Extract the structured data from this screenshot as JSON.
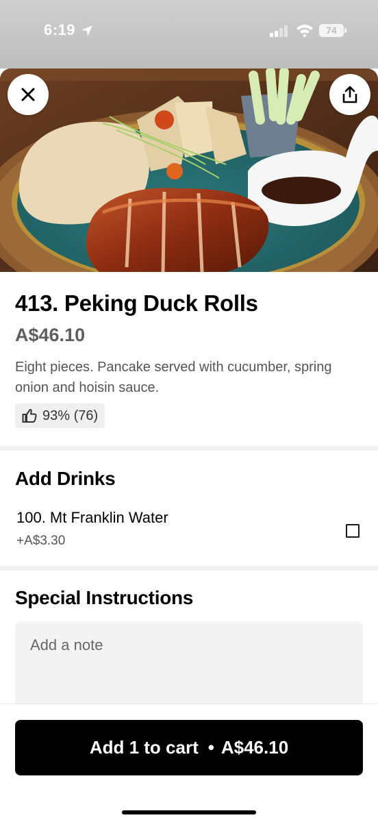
{
  "status_bar": {
    "time": "6:19",
    "battery": "74",
    "icons": [
      "location-arrow-icon",
      "cellular-signal-icon",
      "wifi-icon",
      "battery-icon"
    ]
  },
  "hero": {
    "image": "food-photo",
    "close_icon": "close-icon",
    "share_icon": "share-icon"
  },
  "item": {
    "title": "413. Peking Duck Rolls",
    "price": "A$46.10",
    "description": "Eight pieces. Pancake served with cucumber, spring onion and hoisin sauce.",
    "rating": "93% (76)",
    "rating_icon": "thumbs-up-icon"
  },
  "drinks": {
    "title": "Add Drinks",
    "options": [
      {
        "name": "100. Mt Franklin Water",
        "price": "+A$3.30",
        "checked": false
      }
    ]
  },
  "instructions": {
    "title": "Special Instructions",
    "placeholder": "Add a note"
  },
  "cart": {
    "label": "Add 1 to cart",
    "separator": "•",
    "price": "A$46.10",
    "bg": "#000000",
    "text": "#ffffff"
  }
}
